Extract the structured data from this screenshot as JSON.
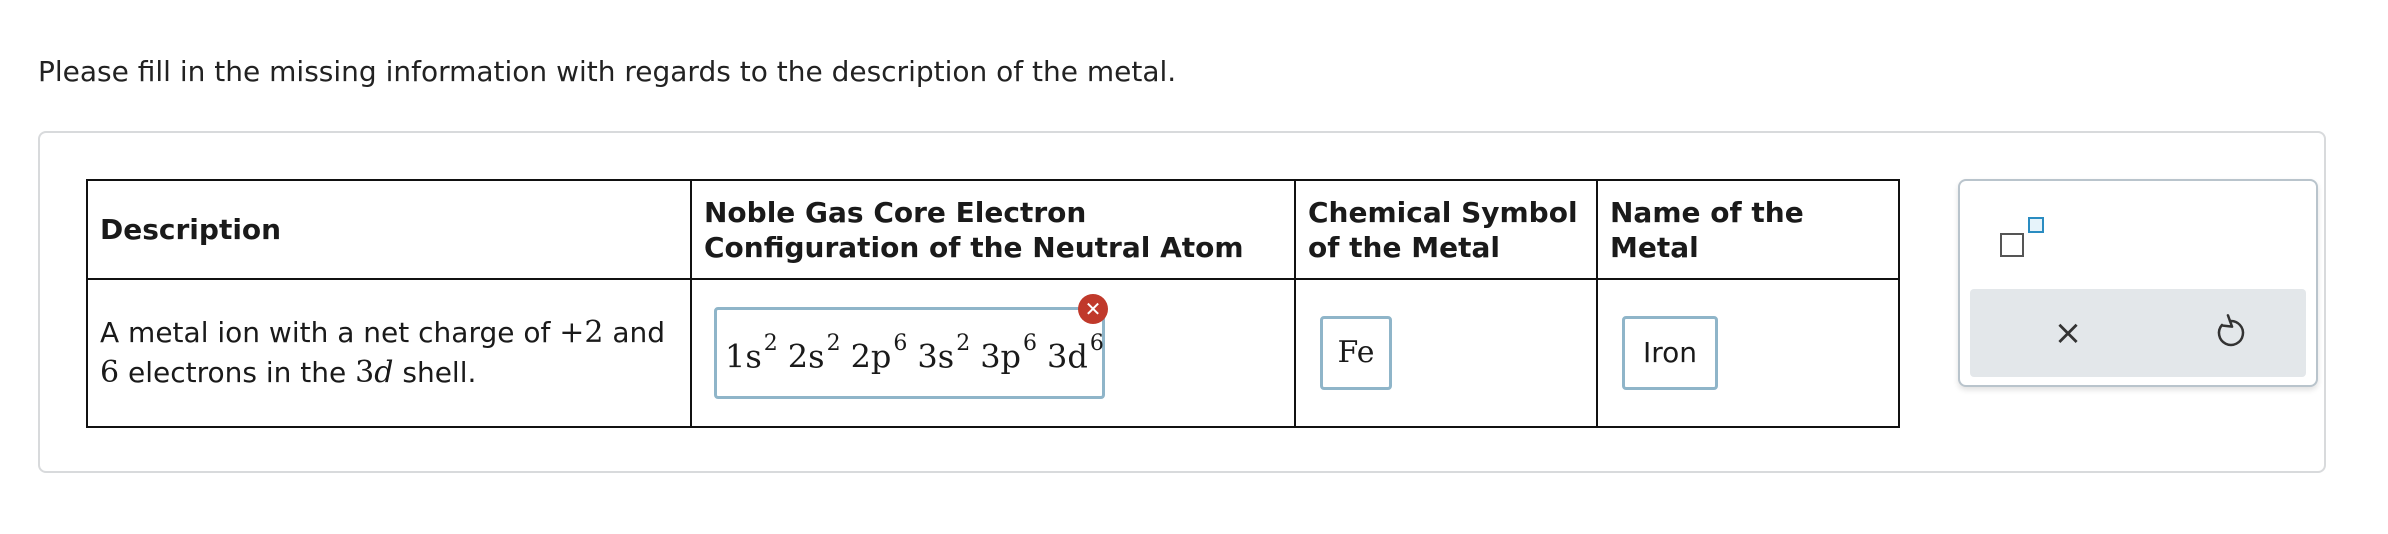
{
  "instruction": "Please fill in the missing information with regards to the description of the metal.",
  "table": {
    "headers": [
      "Description",
      "Noble Gas Core Electron Configuration of the Neutral Atom",
      "Chemical Symbol of the Metal",
      "Name of the Metal"
    ],
    "row": {
      "description_part1": "A metal ion with a net charge of ",
      "charge": "+2",
      "description_part2": " and ",
      "electron_count": "6",
      "description_part3": " electrons in the ",
      "shell_number": "3",
      "shell_letter": "d",
      "description_part4": " shell.",
      "configuration": [
        {
          "orbital": "1s",
          "electrons": "2"
        },
        {
          "orbital": "2s",
          "electrons": "2"
        },
        {
          "orbital": "2p",
          "electrons": "6"
        },
        {
          "orbital": "3s",
          "electrons": "2"
        },
        {
          "orbital": "3p",
          "electrons": "6"
        },
        {
          "orbital": "3d",
          "electrons": "6"
        }
      ],
      "configuration_status": "incorrect",
      "symbol": "Fe",
      "name": "Iron"
    }
  },
  "toolbox": {
    "superscript_tool": "superscript-icon",
    "clear_tool": "×",
    "undo_tool": "undo-icon"
  },
  "colors": {
    "error": "#c0392b",
    "input_border": "#8fb5c9",
    "superscript_accent": "#2a8cc1"
  }
}
